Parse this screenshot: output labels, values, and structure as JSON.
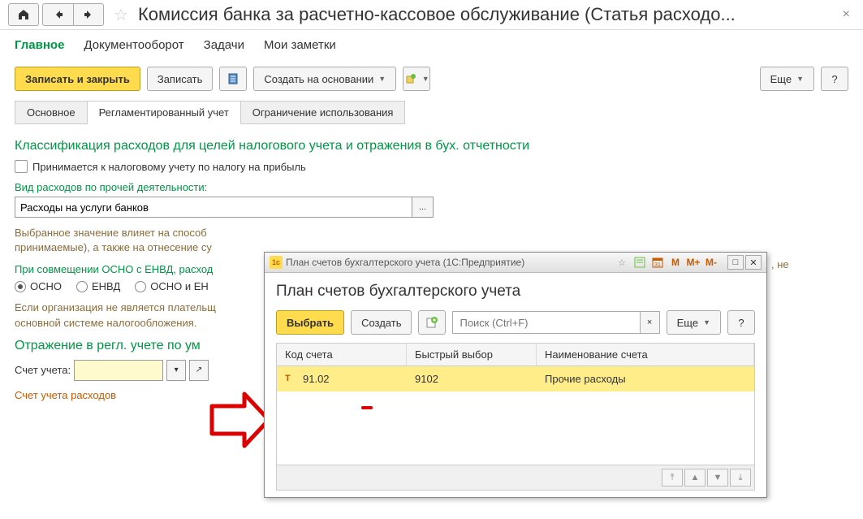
{
  "page": {
    "title": "Комиссия банка за расчетно-кассовое обслуживание (Статья расходо..."
  },
  "tabs": {
    "t1": "Главное",
    "t2": "Документооборот",
    "t3": "Задачи",
    "t4": "Мои заметки"
  },
  "toolbar": {
    "save_close": "Записать и закрыть",
    "save": "Записать",
    "create_on_basis": "Создать на основании",
    "more": "Еще"
  },
  "subtabs": {
    "s1": "Основное",
    "s2": "Регламентированный учет",
    "s3": "Ограничение использования"
  },
  "form": {
    "heading1": "Классификация расходов для целей налогового учета и отражения в бух. отчетности",
    "checkbox1": "Принимается к налоговому учету по налогу на прибыль",
    "label_exp_type": "Вид расходов по прочей деятельности:",
    "exp_type_value": "Расходы на услуги банков",
    "hint1_a": "Выбранное значение влияет на способ",
    "hint1_b": "принимаемые), а также на отнесение су",
    "hint1_tail": ", не",
    "label_combined": "При совмещении ОСНО с ЕНВД, расход",
    "radio1": "ОСНО",
    "radio2": "ЕНВД",
    "radio3": "ОСНО и ЕН",
    "hint2_a": "Если организация не является плательщ",
    "hint2_b": "основной системе налогообложения.",
    "heading2": "Отражение в регл. учете по ум",
    "label_account": "Счет учета:",
    "orange_link": "Счет учета расходов"
  },
  "modal": {
    "titlebar": "План счетов бухгалтерского учета  (1С:Предприятие)",
    "heading": "План счетов бухгалтерского учета",
    "select_btn": "Выбрать",
    "create_btn": "Создать",
    "search_placeholder": "Поиск (Ctrl+F)",
    "more": "Еще",
    "m1": "M",
    "m2": "M+",
    "m3": "M-",
    "columns": {
      "c1": "Код счета",
      "c2": "Быстрый выбор",
      "c3": "Наименование счета"
    },
    "row": {
      "code": "91.02",
      "quick": "9102",
      "name": "Прочие расходы"
    }
  }
}
